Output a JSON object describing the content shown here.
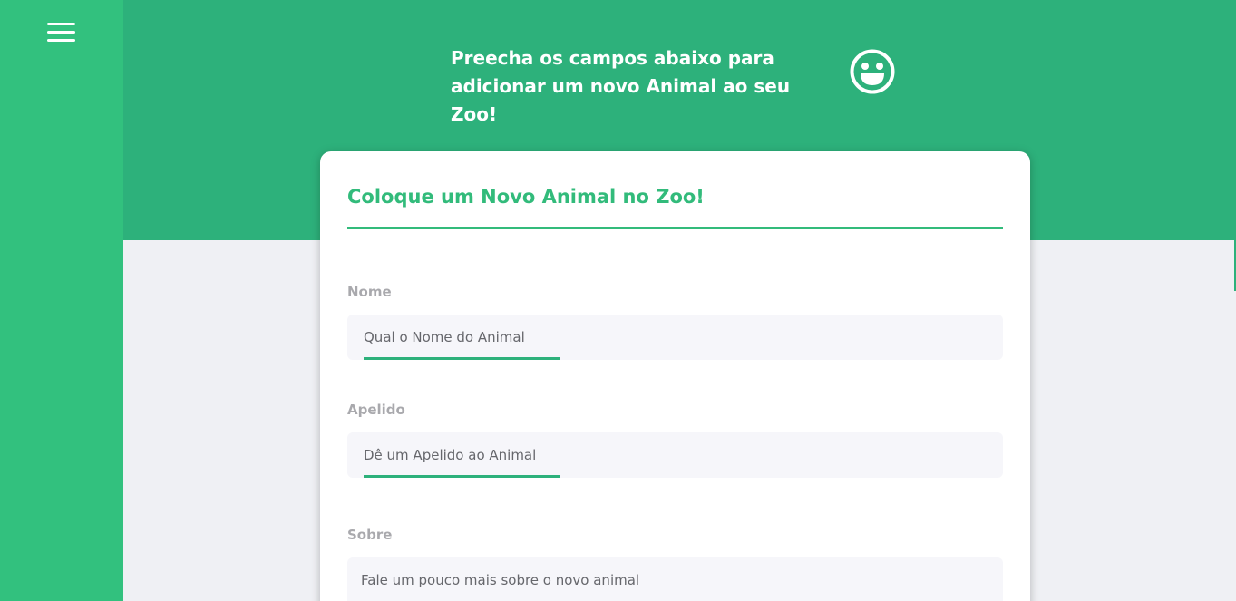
{
  "header": {
    "line1": "Preecha os campos abaixo para",
    "line2": "adicionar um novo Animal ao seu Zoo!",
    "icon": "smiley-icon"
  },
  "sidebar": {
    "menu_icon": "hamburger-menu-icon"
  },
  "form": {
    "title": "Coloque um Novo Animal no Zoo!",
    "fields": [
      {
        "label": "Nome",
        "placeholder": "Qual o Nome do Animal",
        "value": ""
      },
      {
        "label": "Apelido",
        "placeholder": "Dê um Apelido ao Animal",
        "value": ""
      },
      {
        "label": "Sobre",
        "placeholder": "Fale um pouco mais sobre o novo animal",
        "value": ""
      }
    ]
  },
  "colors": {
    "sidebar": "#32c17e",
    "header": "#2db17b",
    "accent": "#32bb7b",
    "background": "#eff0f4",
    "input_bg": "#f6f6fa"
  }
}
